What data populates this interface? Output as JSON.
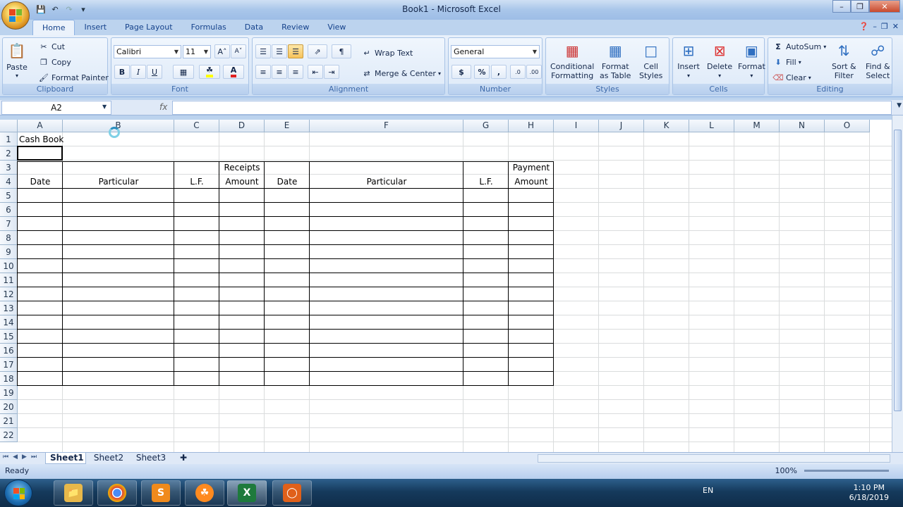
{
  "window": {
    "title": "Book1 - Microsoft Excel"
  },
  "ribbon_tabs": [
    "Home",
    "Insert",
    "Page Layout",
    "Formulas",
    "Data",
    "Review",
    "View"
  ],
  "clipboard": {
    "paste": "Paste",
    "cut": "Cut",
    "copy": "Copy",
    "format_painter": "Format Painter",
    "label": "Clipboard"
  },
  "font": {
    "name": "Calibri",
    "size": "11",
    "label": "Font",
    "bold": "B",
    "italic": "I",
    "underline": "U"
  },
  "alignment": {
    "wrap_text": "Wrap Text",
    "merge_center": "Merge & Center",
    "label": "Alignment"
  },
  "number": {
    "format": "General",
    "currency": "$",
    "percent": "%",
    "comma": ",",
    "label": "Number"
  },
  "styles": {
    "conditional": "Conditional",
    "formatting": "Formatting",
    "format_as": "Format",
    "as_table": "as Table",
    "cell": "Cell",
    "cell_styles": "Styles",
    "label": "Styles"
  },
  "cells": {
    "insert": "Insert",
    "delete": "Delete",
    "format": "Format",
    "label": "Cells"
  },
  "editing": {
    "autosum": "AutoSum",
    "fill": "Fill",
    "clear": "Clear",
    "sort": "Sort &",
    "filter": "Filter",
    "find": "Find &",
    "select": "Select",
    "label": "Editing"
  },
  "formula_bar": {
    "name_box": "A2",
    "fx": "fx",
    "content": ""
  },
  "columns": [
    "A",
    "B",
    "C",
    "D",
    "E",
    "F",
    "G",
    "H",
    "I",
    "J",
    "K",
    "L",
    "M",
    "N",
    "O"
  ],
  "rows": [
    "1",
    "2",
    "3",
    "4",
    "5",
    "6",
    "7",
    "8",
    "9",
    "10",
    "11",
    "12",
    "13",
    "14",
    "15",
    "16",
    "17",
    "18",
    "19",
    "20",
    "21",
    "22"
  ],
  "sheet": {
    "title_cell": "Cash Book",
    "headers": {
      "date_left": "Date",
      "particular_left": "Particular",
      "lf_left": "L.F.",
      "receipts_line1": "Receipts",
      "receipts_line2": "Amount",
      "date_right": "Date",
      "particular_right": "Particular",
      "lf_right": "L.F.",
      "payment_line1": "Payment",
      "payment_line2": "Amount"
    }
  },
  "sheet_tabs": [
    "Sheet1",
    "Sheet2",
    "Sheet3"
  ],
  "status": {
    "ready": "Ready",
    "zoom": "100%"
  },
  "taskbar": {
    "lang": "EN",
    "time": "1:10 PM",
    "date": "6/18/2019"
  }
}
